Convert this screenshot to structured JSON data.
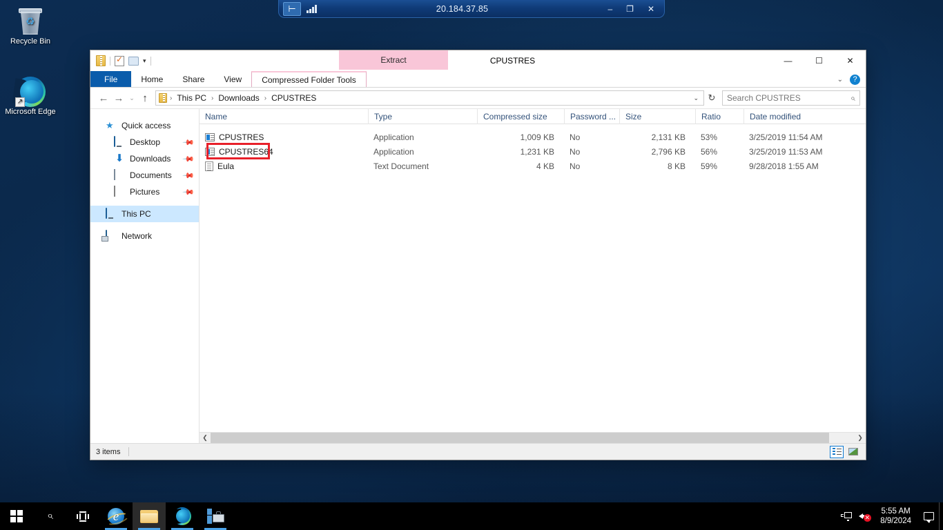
{
  "desktop": {
    "icons": [
      {
        "label": "Recycle Bin",
        "icon": "recycle-bin-icon"
      },
      {
        "label": "Microsoft Edge",
        "icon": "edge-icon"
      }
    ]
  },
  "rdp_bar": {
    "title": "20.184.37.85",
    "pin_icon": "pin-icon",
    "signal_icon": "signal-strength-icon",
    "minimize": "–",
    "restore": "❐",
    "close": "✕"
  },
  "explorer": {
    "window_title": "CPUSTRES",
    "quick_access_toolbar": {
      "zip_icon": "zip-folder-icon",
      "properties_icon": "properties-icon",
      "new_folder_icon": "new-folder-icon",
      "dropdown_icon": "chevron-down-icon"
    },
    "window_controls": {
      "minimize": "—",
      "maximize": "☐",
      "close": "✕"
    },
    "contextual_tab_group": "Extract",
    "tabs": [
      {
        "label": "File",
        "type": "file"
      },
      {
        "label": "Home",
        "type": "normal"
      },
      {
        "label": "Share",
        "type": "normal"
      },
      {
        "label": "View",
        "type": "normal"
      },
      {
        "label": "Compressed Folder Tools",
        "type": "contextual"
      }
    ],
    "ribbon_collapse_icon": "chevron-down-icon",
    "help_label": "?",
    "nav": {
      "back": "←",
      "forward": "→",
      "recent": "⌄",
      "up": "↑"
    },
    "address": {
      "icon": "zip-folder-icon",
      "crumbs": [
        "This PC",
        "Downloads",
        "CPUSTRES"
      ],
      "separator": "›",
      "dropdown_icon": "chevron-down-icon",
      "refresh_icon": "refresh-icon",
      "refresh_glyph": "↻"
    },
    "search": {
      "placeholder": "Search CPUSTRES",
      "icon": "search-icon"
    },
    "sidebar": [
      {
        "label": "Quick access",
        "icon": "star-icon",
        "child": false,
        "pinned": false,
        "selected": false
      },
      {
        "label": "Desktop",
        "icon": "desktop-icon",
        "child": true,
        "pinned": true,
        "selected": false
      },
      {
        "label": "Downloads",
        "icon": "downloads-icon",
        "child": true,
        "pinned": true,
        "selected": false
      },
      {
        "label": "Documents",
        "icon": "documents-icon",
        "child": true,
        "pinned": true,
        "selected": false
      },
      {
        "label": "Pictures",
        "icon": "pictures-icon",
        "child": true,
        "pinned": true,
        "selected": false
      },
      {
        "label": "This PC",
        "icon": "this-pc-icon",
        "child": false,
        "pinned": false,
        "selected": true
      },
      {
        "label": "Network",
        "icon": "network-icon",
        "child": false,
        "pinned": false,
        "selected": false
      }
    ],
    "columns": [
      {
        "label": "Name",
        "sorted": true,
        "sort_glyph": "⌃"
      },
      {
        "label": "Type",
        "sorted": false
      },
      {
        "label": "Compressed size",
        "sorted": false
      },
      {
        "label": "Password ...",
        "sorted": false
      },
      {
        "label": "Size",
        "sorted": false
      },
      {
        "label": "Ratio",
        "sorted": false
      },
      {
        "label": "Date modified",
        "sorted": false
      }
    ],
    "files": [
      {
        "name": "CPUSTRES",
        "icon": "application-file-icon",
        "type": "Application",
        "compressed_size": "1,009 KB",
        "password": "No",
        "size": "2,131 KB",
        "ratio": "53%",
        "date_modified": "3/25/2019 11:54 AM",
        "highlighted": false
      },
      {
        "name": "CPUSTRES64",
        "icon": "application-file-icon",
        "type": "Application",
        "compressed_size": "1,231 KB",
        "password": "No",
        "size": "2,796 KB",
        "ratio": "56%",
        "date_modified": "3/25/2019 11:53 AM",
        "highlighted": true
      },
      {
        "name": "Eula",
        "icon": "text-document-icon",
        "type": "Text Document",
        "compressed_size": "4 KB",
        "password": "No",
        "size": "8 KB",
        "ratio": "59%",
        "date_modified": "9/28/2018 1:55 AM",
        "highlighted": false
      }
    ],
    "annotation_color": "#e8202a",
    "scrollbar": {
      "left_arrow": "❮",
      "right_arrow": "❯"
    },
    "status": {
      "item_count": "3 items",
      "view_details_icon": "details-view-icon",
      "view_large_icons_icon": "large-icons-view-icon"
    }
  },
  "taskbar": {
    "start_icon": "windows-start-icon",
    "search_icon": "search-icon",
    "task_view_icon": "task-view-icon",
    "apps": [
      {
        "name": "internet-explorer-icon",
        "state": "open"
      },
      {
        "name": "file-explorer-icon",
        "state": "active"
      },
      {
        "name": "microsoft-edge-icon",
        "state": "open"
      },
      {
        "name": "server-manager-icon",
        "state": "open"
      }
    ],
    "tray": {
      "network_icon": "network-icon",
      "volume_icon": "volume-muted-icon",
      "volume_mute_mark": "✕",
      "time": "5:55 AM",
      "date": "8/9/2024",
      "action_center_icon": "action-center-icon"
    }
  }
}
